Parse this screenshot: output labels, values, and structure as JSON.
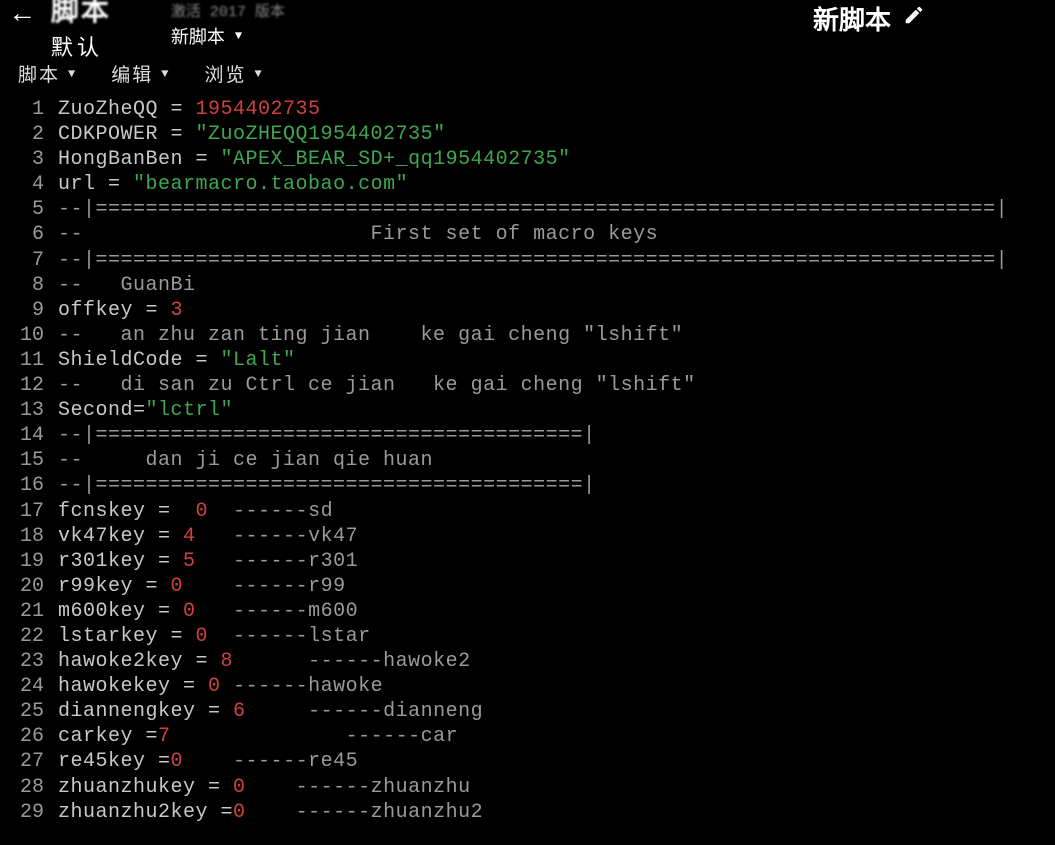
{
  "header": {
    "back_label": "←",
    "title_top": "脚本",
    "title_sub": "默认",
    "doc_meta": "激活 2017 版本",
    "doc_name": "新脚本",
    "right_title": "新脚本"
  },
  "menubar": {
    "m1": "脚本",
    "m2": "编辑",
    "m3": "浏览"
  },
  "lines": [
    {
      "n": 1,
      "tokens": [
        [
          "id",
          "ZuoZheQQ"
        ],
        [
          "op",
          " = "
        ],
        [
          "num",
          "1954402735"
        ]
      ]
    },
    {
      "n": 2,
      "tokens": [
        [
          "id",
          "CDKPOWER"
        ],
        [
          "op",
          " = "
        ],
        [
          "str",
          "\"ZuoZHEQQ1954402735\""
        ]
      ]
    },
    {
      "n": 3,
      "tokens": [
        [
          "id",
          "HongBanBen"
        ],
        [
          "op",
          " = "
        ],
        [
          "str",
          "\"APEX_BEAR_SD+_qq1954402735\""
        ]
      ]
    },
    {
      "n": 4,
      "tokens": [
        [
          "id",
          "url"
        ],
        [
          "op",
          " = "
        ],
        [
          "str",
          "\"bearmacro.taobao.com\""
        ]
      ]
    },
    {
      "n": 5,
      "tokens": [
        [
          "com",
          "--|========================================================================|"
        ]
      ]
    },
    {
      "n": 6,
      "tokens": [
        [
          "com",
          "--                       First set of macro keys"
        ]
      ]
    },
    {
      "n": 7,
      "tokens": [
        [
          "com",
          "--|========================================================================|"
        ]
      ]
    },
    {
      "n": 8,
      "tokens": [
        [
          "com",
          "--   GuanBi"
        ]
      ]
    },
    {
      "n": 9,
      "tokens": [
        [
          "id",
          "offkey"
        ],
        [
          "op",
          " = "
        ],
        [
          "num",
          "3"
        ]
      ]
    },
    {
      "n": 10,
      "tokens": [
        [
          "com",
          "--   an zhu zan ting jian    ke gai cheng \"lshift\""
        ]
      ]
    },
    {
      "n": 11,
      "tokens": [
        [
          "id",
          "ShieldCode"
        ],
        [
          "op",
          " = "
        ],
        [
          "str",
          "\"Lalt\""
        ]
      ]
    },
    {
      "n": 12,
      "tokens": [
        [
          "com",
          "--   di san zu Ctrl ce jian   ke gai cheng \"lshift\""
        ]
      ]
    },
    {
      "n": 13,
      "tokens": [
        [
          "id",
          "Second"
        ],
        [
          "op",
          "="
        ],
        [
          "str",
          "\"lctrl\""
        ]
      ]
    },
    {
      "n": 14,
      "tokens": [
        [
          "com",
          "--|=======================================|"
        ]
      ]
    },
    {
      "n": 15,
      "tokens": [
        [
          "com",
          "--     dan ji ce jian qie huan"
        ]
      ]
    },
    {
      "n": 16,
      "tokens": [
        [
          "com",
          "--|=======================================|"
        ]
      ]
    },
    {
      "n": 17,
      "tokens": [
        [
          "id",
          "fcnskey"
        ],
        [
          "op",
          " =  "
        ],
        [
          "num",
          "0"
        ],
        [
          "com",
          "  ------sd"
        ]
      ]
    },
    {
      "n": 18,
      "tokens": [
        [
          "id",
          "vk47key"
        ],
        [
          "op",
          " = "
        ],
        [
          "num",
          "4"
        ],
        [
          "com",
          "   ------vk47"
        ]
      ]
    },
    {
      "n": 19,
      "tokens": [
        [
          "id",
          "r301key"
        ],
        [
          "op",
          " = "
        ],
        [
          "num",
          "5"
        ],
        [
          "com",
          "   ------r301"
        ]
      ]
    },
    {
      "n": 20,
      "tokens": [
        [
          "id",
          "r99key"
        ],
        [
          "op",
          " = "
        ],
        [
          "num",
          "0"
        ],
        [
          "com",
          "    ------r99"
        ]
      ]
    },
    {
      "n": 21,
      "tokens": [
        [
          "id",
          "m600key"
        ],
        [
          "op",
          " = "
        ],
        [
          "num",
          "0"
        ],
        [
          "com",
          "   ------m600"
        ]
      ]
    },
    {
      "n": 22,
      "tokens": [
        [
          "id",
          "lstarkey"
        ],
        [
          "op",
          " = "
        ],
        [
          "num",
          "0"
        ],
        [
          "com",
          "  ------lstar"
        ]
      ]
    },
    {
      "n": 23,
      "tokens": [
        [
          "id",
          "hawoke2key"
        ],
        [
          "op",
          " = "
        ],
        [
          "num",
          "8"
        ],
        [
          "com",
          "      ------hawoke2"
        ]
      ]
    },
    {
      "n": 24,
      "tokens": [
        [
          "id",
          "hawokekey"
        ],
        [
          "op",
          " = "
        ],
        [
          "num",
          "0"
        ],
        [
          "com",
          " ------hawoke"
        ]
      ]
    },
    {
      "n": 25,
      "tokens": [
        [
          "id",
          "diannengkey"
        ],
        [
          "op",
          " = "
        ],
        [
          "num",
          "6"
        ],
        [
          "com",
          "     ------dianneng"
        ]
      ]
    },
    {
      "n": 26,
      "tokens": [
        [
          "id",
          "carkey"
        ],
        [
          "op",
          " ="
        ],
        [
          "num",
          "7"
        ],
        [
          "com",
          "              ------car"
        ]
      ]
    },
    {
      "n": 27,
      "tokens": [
        [
          "id",
          "re45key"
        ],
        [
          "op",
          " ="
        ],
        [
          "num",
          "0"
        ],
        [
          "com",
          "    ------re45"
        ]
      ]
    },
    {
      "n": 28,
      "tokens": [
        [
          "id",
          "zhuanzhukey"
        ],
        [
          "op",
          " = "
        ],
        [
          "num",
          "0"
        ],
        [
          "com",
          "    ------zhuanzhu"
        ]
      ]
    },
    {
      "n": 29,
      "tokens": [
        [
          "id",
          "zhuanzhu2key"
        ],
        [
          "op",
          " ="
        ],
        [
          "num",
          "0"
        ],
        [
          "com",
          "    ------zhuanzhu2"
        ]
      ]
    }
  ]
}
